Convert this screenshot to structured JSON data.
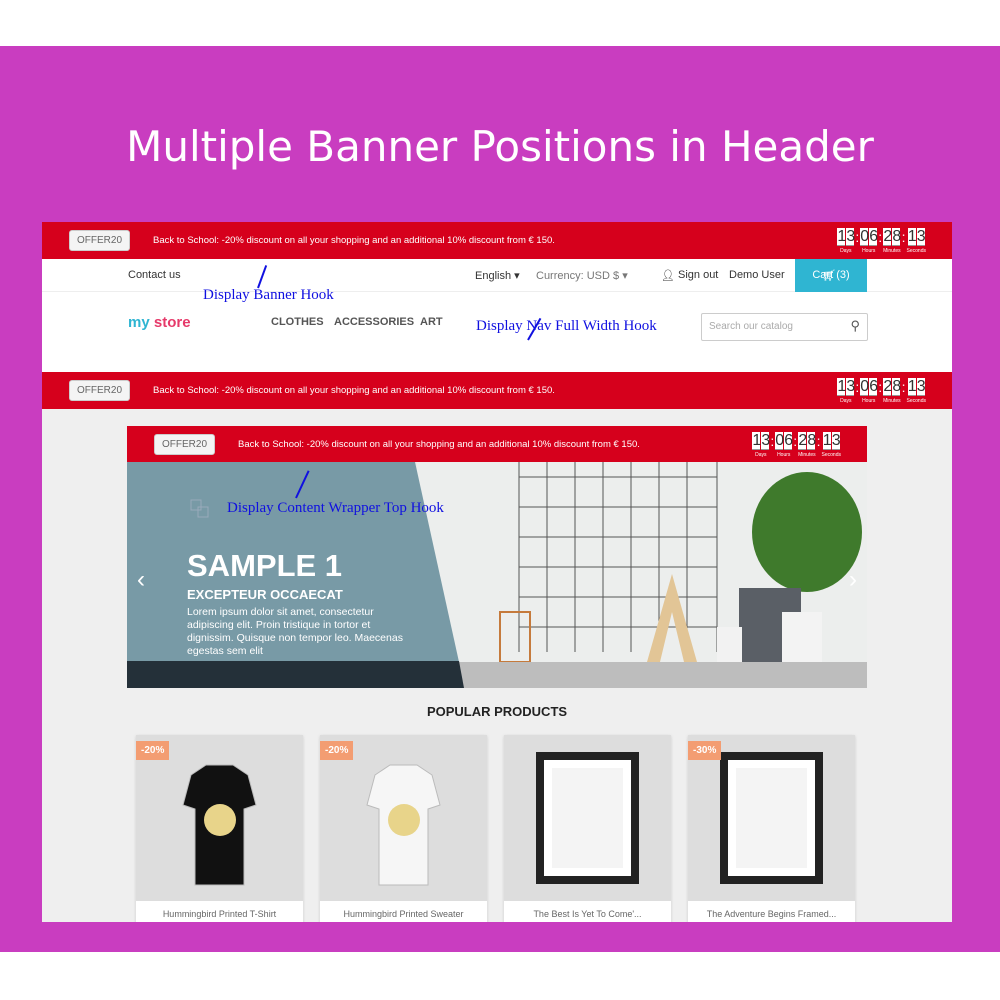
{
  "page_title": "Multiple Banner Positions in Header",
  "banner": {
    "offer_code": "OFFER20",
    "message": "Back to School: -20% discount on all your shopping and an additional 10% discount from € 150.",
    "countdown": [
      {
        "digits": "13",
        "label": "Days"
      },
      {
        "digits": "06",
        "label": "Hours"
      },
      {
        "digits": "28",
        "label": "Minutes"
      },
      {
        "digits": "13",
        "label": "Seconds"
      }
    ]
  },
  "nav": {
    "contact": "Contact us",
    "language": "English",
    "currency": "Currency: USD $",
    "sign_out": "Sign out",
    "user": "Demo User",
    "cart": "Cart (3)"
  },
  "header": {
    "logo": "my store",
    "menu": [
      "CLOTHES",
      "ACCESSORIES",
      "ART"
    ],
    "search_placeholder": "Search our catalog"
  },
  "hooks": {
    "banner": "Display Banner Hook",
    "nav_full": "Display Nav Full Width Hook",
    "content_top": "Display Content Wrapper Top Hook"
  },
  "slider": {
    "title": "SAMPLE 1",
    "subtitle": "EXCEPTEUR OCCAECAT",
    "text": "Lorem ipsum dolor sit amet, consectetur adipiscing elit. Proin tristique in tortor et dignissim. Quisque non tempor leo. Maecenas egestas sem elit"
  },
  "products_heading": "POPULAR PRODUCTS",
  "products": [
    {
      "name": "Hummingbird Printed T-Shirt",
      "discount": "-20%"
    },
    {
      "name": "Hummingbird Printed Sweater",
      "discount": "-20%"
    },
    {
      "name": "The Best Is Yet To Come'...",
      "discount": ""
    },
    {
      "name": "The Adventure Begins Framed...",
      "discount": "-30%"
    }
  ],
  "colors": {
    "purple": "#c93dc0",
    "banner_red": "#d6001c",
    "cart_blue": "#2fb5d2",
    "hook_blue": "#1010e0"
  }
}
